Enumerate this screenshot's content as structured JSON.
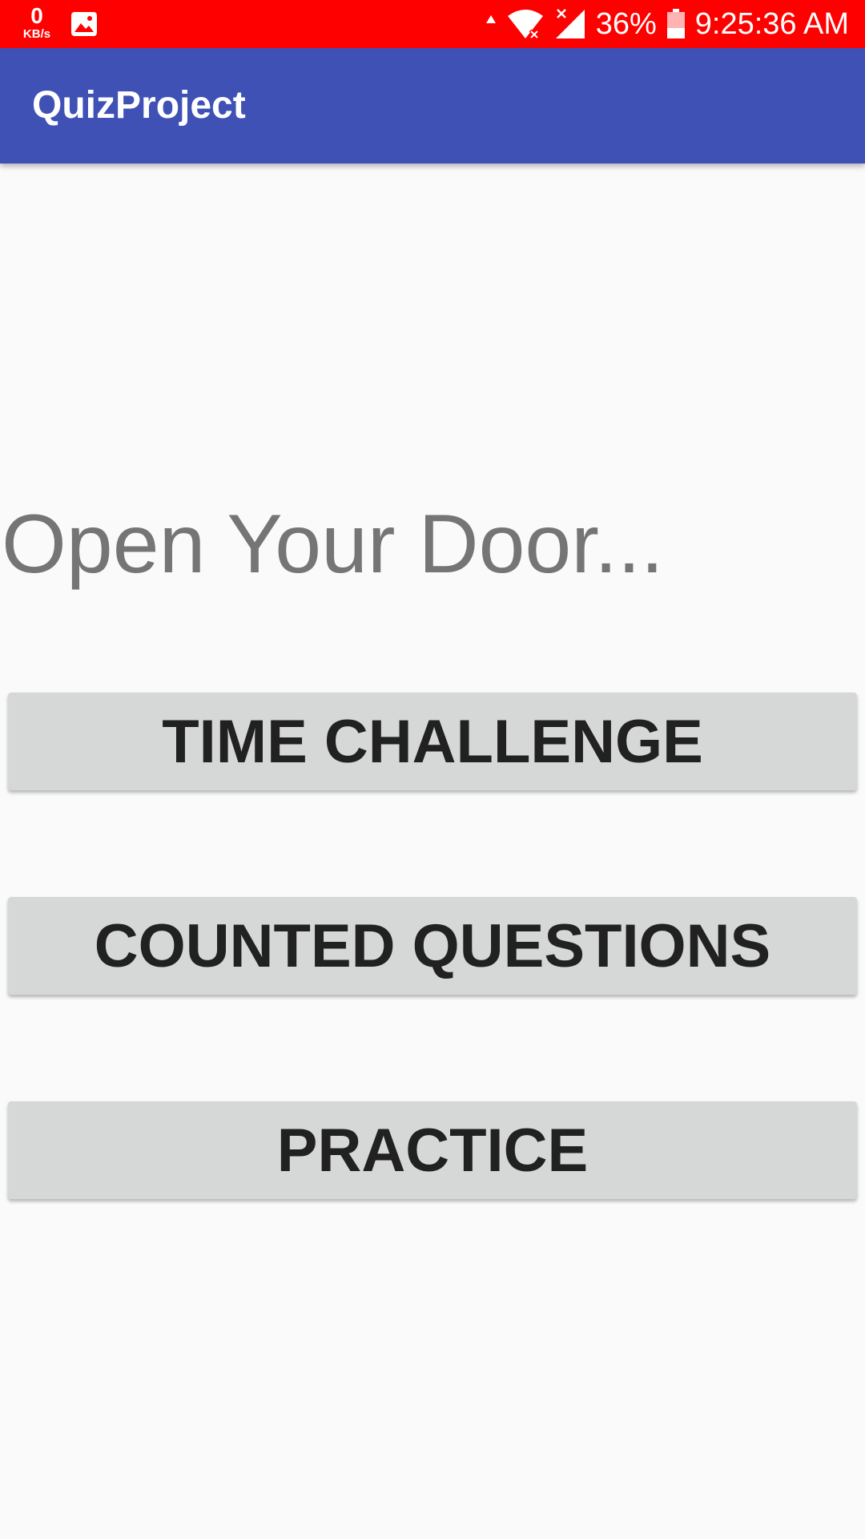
{
  "status_bar": {
    "net_speed_value": "0",
    "net_speed_unit": "KB/s",
    "battery_percent": "36%",
    "time": "9:25:36 AM",
    "background_color": "#ff0000",
    "icons": [
      "gallery-icon",
      "data-arrow-icon",
      "wifi-icon",
      "signal-icon",
      "battery-icon"
    ]
  },
  "app_bar": {
    "title": "QuizProject",
    "color": "#3f51b5"
  },
  "main": {
    "headline": "Open Your Door...",
    "buttons": [
      {
        "label": "TIME CHALLENGE"
      },
      {
        "label": "COUNTED QUESTIONS"
      },
      {
        "label": "PRACTICE"
      }
    ]
  }
}
